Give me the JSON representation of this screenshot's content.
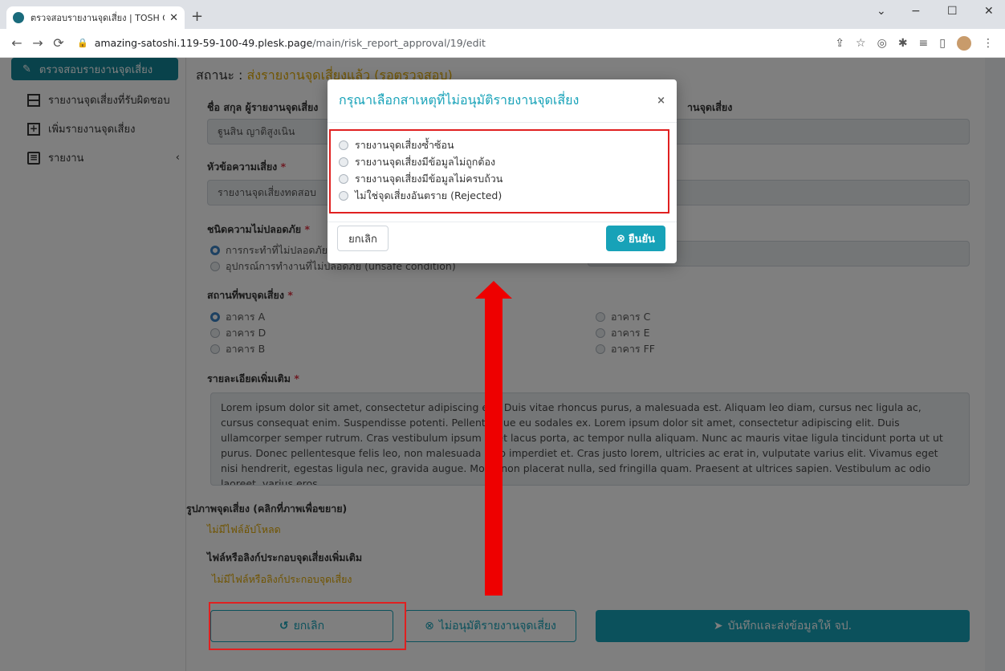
{
  "browser": {
    "tab_title": "ตรวจสอบรายงานจุดเสี่ยง | TOSH Goo",
    "new_tab": "+",
    "url_host": "amazing-satoshi.119-59-100-49.plesk.page",
    "url_path": "/main/risk_report_approval/19/edit",
    "win_minimize": "−",
    "win_maximize": "☐",
    "win_close": "✕",
    "win_chevron": "⌄"
  },
  "sidebar": {
    "active": "ตรวจสอบรายงานจุดเสี่ยง",
    "items": [
      {
        "label": "รายงานจุดเสี่ยงที่รับผิดชอบ",
        "icon": "table-icon"
      },
      {
        "label": "เพิ่มรายงานจุดเสี่ยง",
        "icon": "plus-square-icon"
      },
      {
        "label": "รายงาน",
        "icon": "file-icon",
        "chevron": "‹"
      }
    ]
  },
  "form": {
    "status_label": "สถานะ : ",
    "status_value": "ส่งรายงานจุดเสี่ยงแล้ว (รอตรวจสอบ)",
    "reporter_label": "ชื่อ สกุล ผู้รายงานจุดเสี่ยง",
    "reporter_value": "ฐูนสิน ญาติสูงเนิน",
    "owner_label": "านจุดเสี่ยง",
    "topic_label": "หัวข้อความเสี่ยง",
    "topic_value": "รายงานจุดเสี่ยงทดสอบ",
    "unsafe_label": "ชนิดความไม่ปลอดภัย",
    "unsafe_options": [
      "การกระทำที่ไม่ปลอดภัย",
      "อุปกรณ์การทำงานที่ไม่ปลอดภัย (unsafe condition)"
    ],
    "location_label": "สถานที่พบจุดเสี่ยง",
    "locations_left": [
      "อาคาร A",
      "อาคาร D",
      "อาคาร B"
    ],
    "locations_right": [
      "อาคาร C",
      "อาคาร E",
      "อาคาร FF"
    ],
    "detail_label": "รายละเอียดเพิ่มเติม",
    "detail_text": "Lorem ipsum dolor sit amet, consectetur adipiscing elit. Duis vitae rhoncus purus, a malesuada est. Aliquam leo diam, cursus nec ligula ac, cursus consequat enim. Suspendisse potenti. Pellentesque eu sodales ex. Lorem ipsum dolor sit amet, consectetur adipiscing elit. Duis ullamcorper semper rutrum. Cras vestibulum ipsum eget lacus porta, ac tempor nulla aliquam. Nunc ac mauris vitae ligula tincidunt porta ut ut purus. Donec pellentesque felis leo, non malesuada odio imperdiet et. Cras justo lorem, ultricies ac erat in, vulputate varius elit. Vivamus eget nisi hendrerit, egestas ligula nec, gravida augue. Morbi non placerat nulla, sed fringilla quam. Praesent at ultrices sapien. Vestibulum ac odio laoreet, varius eros",
    "image_label": "รูปภาพจุดเสี่ยง (คลิกที่ภาพเพื่อขยาย)",
    "image_empty": "ไม่มีไฟล์อัปโหลด",
    "file_label": "ไฟล์หรือลิงก์ประกอบจุดเสี่ยงเพิ่มเติม",
    "file_empty": "ไม่มีไฟล์หรือลิงก์ประกอบจุดเสี่ยง",
    "required_mark": "*",
    "btn_cancel": "ยกเลิก",
    "btn_reject": "ไม่อนุมัติรายงานจุดเสี่ยง",
    "btn_save": "บันทึกและส่งข้อมูลให้ จป."
  },
  "modal": {
    "title": "กรุณาเลือกสาเหตุที่ไม่อนุมัติรายงานจุดเสี่ยง",
    "close": "×",
    "options": [
      "รายงานจุดเสี่ยงซ้ำซ้อน",
      "รายงานจุดเสี่ยงมีข้อมูลไม่ถูกต้อง",
      "รายงานจุดเสี่ยงมีข้อมูลไม่ครบถ้วน",
      "ไม่ใช่จุดเสี่ยงอันตราย (Rejected)"
    ],
    "cancel": "ยกเลิก",
    "confirm": "ยืนยัน"
  },
  "colors": {
    "accent": "#17a2b8",
    "warning": "#e0a800",
    "annotation": "#ee0000"
  }
}
